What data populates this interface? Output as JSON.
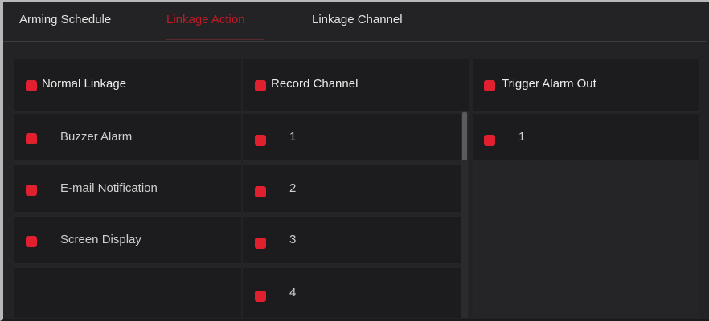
{
  "tabs": [
    {
      "label": "Arming Schedule",
      "active": false
    },
    {
      "label": "Linkage Action",
      "active": true
    },
    {
      "label": "Linkage Channel",
      "active": false
    }
  ],
  "normal_linkage": {
    "header": "Normal Linkage",
    "items": [
      "Buzzer Alarm",
      "E-mail Notification",
      "Screen Display"
    ]
  },
  "record_channel": {
    "header": "Record Channel",
    "items": [
      "1",
      "2",
      "3",
      "4"
    ]
  },
  "trigger_alarm_out": {
    "header": "Trigger Alarm Out",
    "items": [
      "1"
    ]
  },
  "colors": {
    "accent": "#c21a26",
    "checkbox": "#e0202e",
    "background": "#232325"
  }
}
